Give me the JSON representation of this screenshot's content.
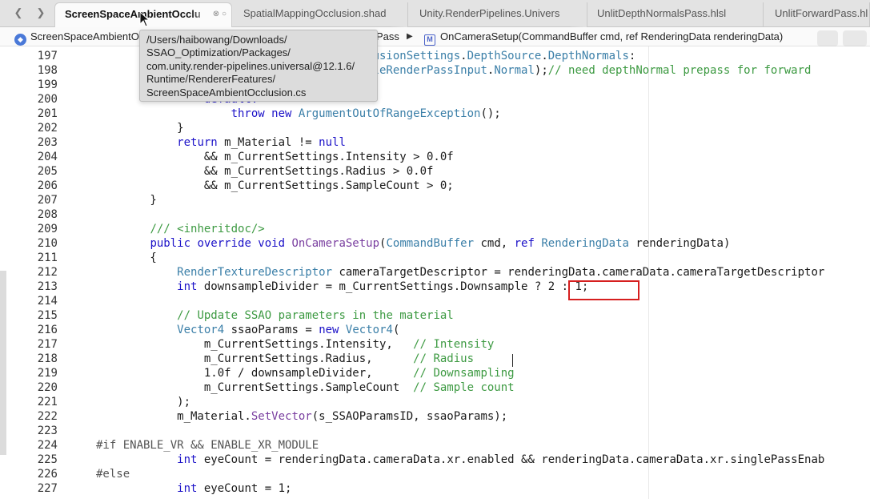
{
  "tabs": [
    {
      "label": "ScreenSpaceAmbientOcclu",
      "active": true
    },
    {
      "label": "SpatialMappingOcclusion.shad",
      "active": false
    },
    {
      "label": "Unity.RenderPipelines.Univers",
      "active": false
    },
    {
      "label": "UnlitDepthNormalsPass.hlsl",
      "active": false
    },
    {
      "label": "UnlitForwardPass.hl",
      "active": false
    }
  ],
  "breadcrumb": {
    "file": "ScreenSpaceAmbientO",
    "class": "Pass",
    "member": "OnCameraSetup(CommandBuffer cmd, ref RenderingData renderingData)"
  },
  "tooltip": {
    "lines": [
      "/Users/haibowang/Downloads/",
      "SSAO_Optimization/Packages/",
      "com.unity.render-pipelines.universal@12.1.6/",
      "Runtime/RendererFeatures/",
      "ScreenSpaceAmbientOcclusion.cs"
    ]
  },
  "code": {
    "lines": [
      {
        "n": "197",
        "segs": [
          {
            "t": "                                  "
          },
          {
            "t": "entOcclusionSettings",
            "c": "ty"
          },
          {
            "t": "."
          },
          {
            "t": "DepthSource",
            "c": "ty"
          },
          {
            "t": "."
          },
          {
            "t": "DepthNormals",
            "c": "ty"
          },
          {
            "t": ":"
          }
        ]
      },
      {
        "n": "198",
        "segs": [
          {
            "t": "                                  "
          },
          {
            "t": "criptableRenderPassInput",
            "c": "ty"
          },
          {
            "t": "."
          },
          {
            "t": "Normal",
            "c": "ty"
          },
          {
            "t": ");"
          },
          {
            "t": "// need depthNormal prepass for forward",
            "c": "cm"
          }
        ]
      },
      {
        "n": "199",
        "segs": [
          {
            "t": ""
          }
        ]
      },
      {
        "n": "200",
        "segs": [
          {
            "t": "                "
          },
          {
            "t": "default:",
            "c": "kw"
          }
        ]
      },
      {
        "n": "201",
        "segs": [
          {
            "t": "                    "
          },
          {
            "t": "throw new",
            "c": "kw"
          },
          {
            "t": " "
          },
          {
            "t": "ArgumentOutOfRangeException",
            "c": "ty"
          },
          {
            "t": "();"
          }
        ]
      },
      {
        "n": "202",
        "segs": [
          {
            "t": "            }"
          }
        ]
      },
      {
        "n": "203",
        "segs": [
          {
            "t": "            "
          },
          {
            "t": "return",
            "c": "kw"
          },
          {
            "t": " m_Material != "
          },
          {
            "t": "null",
            "c": "kw"
          }
        ]
      },
      {
        "n": "204",
        "segs": [
          {
            "t": "                && m_CurrentSettings.Intensity > 0.0f"
          }
        ]
      },
      {
        "n": "205",
        "segs": [
          {
            "t": "                && m_CurrentSettings.Radius > 0.0f"
          }
        ]
      },
      {
        "n": "206",
        "segs": [
          {
            "t": "                && m_CurrentSettings.SampleCount > 0;"
          }
        ]
      },
      {
        "n": "207",
        "segs": [
          {
            "t": "        }"
          }
        ]
      },
      {
        "n": "208",
        "segs": [
          {
            "t": ""
          }
        ]
      },
      {
        "n": "209",
        "segs": [
          {
            "t": "        "
          },
          {
            "t": "/// <inheritdoc/>",
            "c": "cm"
          }
        ]
      },
      {
        "n": "210",
        "segs": [
          {
            "t": "        "
          },
          {
            "t": "public override void",
            "c": "kw"
          },
          {
            "t": " "
          },
          {
            "t": "OnCameraSetup",
            "c": "fn"
          },
          {
            "t": "("
          },
          {
            "t": "CommandBuffer",
            "c": "ty"
          },
          {
            "t": " cmd, "
          },
          {
            "t": "ref",
            "c": "kw"
          },
          {
            "t": " "
          },
          {
            "t": "RenderingData",
            "c": "ty"
          },
          {
            "t": " renderingData)"
          }
        ]
      },
      {
        "n": "211",
        "segs": [
          {
            "t": "        {"
          }
        ]
      },
      {
        "n": "212",
        "segs": [
          {
            "t": "            "
          },
          {
            "t": "RenderTextureDescriptor",
            "c": "ty"
          },
          {
            "t": " cameraTargetDescriptor = renderingData.cameraData.cameraTargetDescriptor"
          }
        ]
      },
      {
        "n": "213",
        "segs": [
          {
            "t": "            "
          },
          {
            "t": "int",
            "c": "kw"
          },
          {
            "t": " downsampleDivider = m_CurrentSettings.Downsample ? 2 : 1;"
          }
        ]
      },
      {
        "n": "214",
        "segs": [
          {
            "t": ""
          }
        ]
      },
      {
        "n": "215",
        "segs": [
          {
            "t": "            "
          },
          {
            "t": "// Update SSAO parameters in the material",
            "c": "cm"
          }
        ]
      },
      {
        "n": "216",
        "segs": [
          {
            "t": "            "
          },
          {
            "t": "Vector4",
            "c": "ty"
          },
          {
            "t": " ssaoParams = "
          },
          {
            "t": "new",
            "c": "kw"
          },
          {
            "t": " "
          },
          {
            "t": "Vector4",
            "c": "ty"
          },
          {
            "t": "("
          }
        ]
      },
      {
        "n": "217",
        "segs": [
          {
            "t": "                m_CurrentSettings.Intensity,   "
          },
          {
            "t": "// Intensity",
            "c": "cm"
          }
        ]
      },
      {
        "n": "218",
        "segs": [
          {
            "t": "                m_CurrentSettings.Radius,      "
          },
          {
            "t": "// Radius",
            "c": "cm"
          }
        ]
      },
      {
        "n": "219",
        "segs": [
          {
            "t": "                1.0f / downsampleDivider,      "
          },
          {
            "t": "// Downsampling",
            "c": "cm"
          }
        ]
      },
      {
        "n": "220",
        "segs": [
          {
            "t": "                m_CurrentSettings.SampleCount  "
          },
          {
            "t": "// Sample count",
            "c": "cm"
          }
        ]
      },
      {
        "n": "221",
        "segs": [
          {
            "t": "            );"
          }
        ]
      },
      {
        "n": "222",
        "segs": [
          {
            "t": "            m_Material."
          },
          {
            "t": "SetVector",
            "c": "fn"
          },
          {
            "t": "(s_SSAOParamsID, ssaoParams);"
          }
        ]
      },
      {
        "n": "223",
        "segs": [
          {
            "t": ""
          }
        ]
      },
      {
        "n": "224",
        "segs": [
          {
            "t": "#if ENABLE_VR && ENABLE_XR_MODULE",
            "c": "pp"
          }
        ]
      },
      {
        "n": "225",
        "segs": [
          {
            "t": "            "
          },
          {
            "t": "int",
            "c": "kw"
          },
          {
            "t": " eyeCount = renderingData.cameraData.xr.enabled && renderingData.cameraData.xr.singlePassEnab"
          }
        ]
      },
      {
        "n": "226",
        "segs": [
          {
            "t": "#else",
            "c": "pp"
          }
        ]
      },
      {
        "n": "227",
        "segs": [
          {
            "t": "            "
          },
          {
            "t": "int",
            "c": "kw"
          },
          {
            "t": " eyeCount = 1;"
          }
        ]
      }
    ]
  }
}
